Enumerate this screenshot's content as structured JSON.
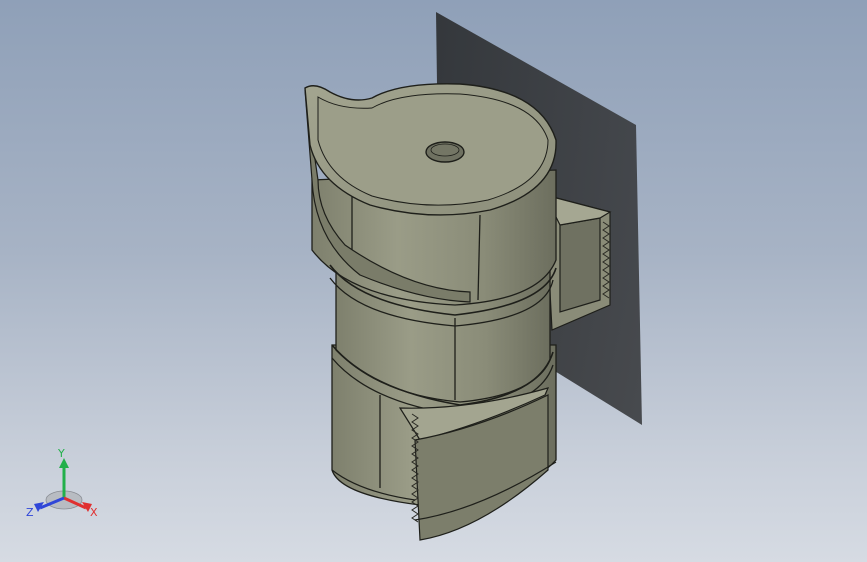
{
  "viewport": {
    "background_top": "#8fa0b8",
    "background_bottom": "#d6dbe3",
    "model_color": "#8d8f7b",
    "model_highlight": "#9fa18c",
    "model_dark": "#6f7161",
    "edge_color": "#1e1f1a",
    "shadow_color": "#2c2e30"
  },
  "triad": {
    "x_label": "X",
    "y_label": "Y",
    "z_label": "Z",
    "x_color": "#e03030",
    "y_color": "#22b04a",
    "z_color": "#2f46d8"
  }
}
